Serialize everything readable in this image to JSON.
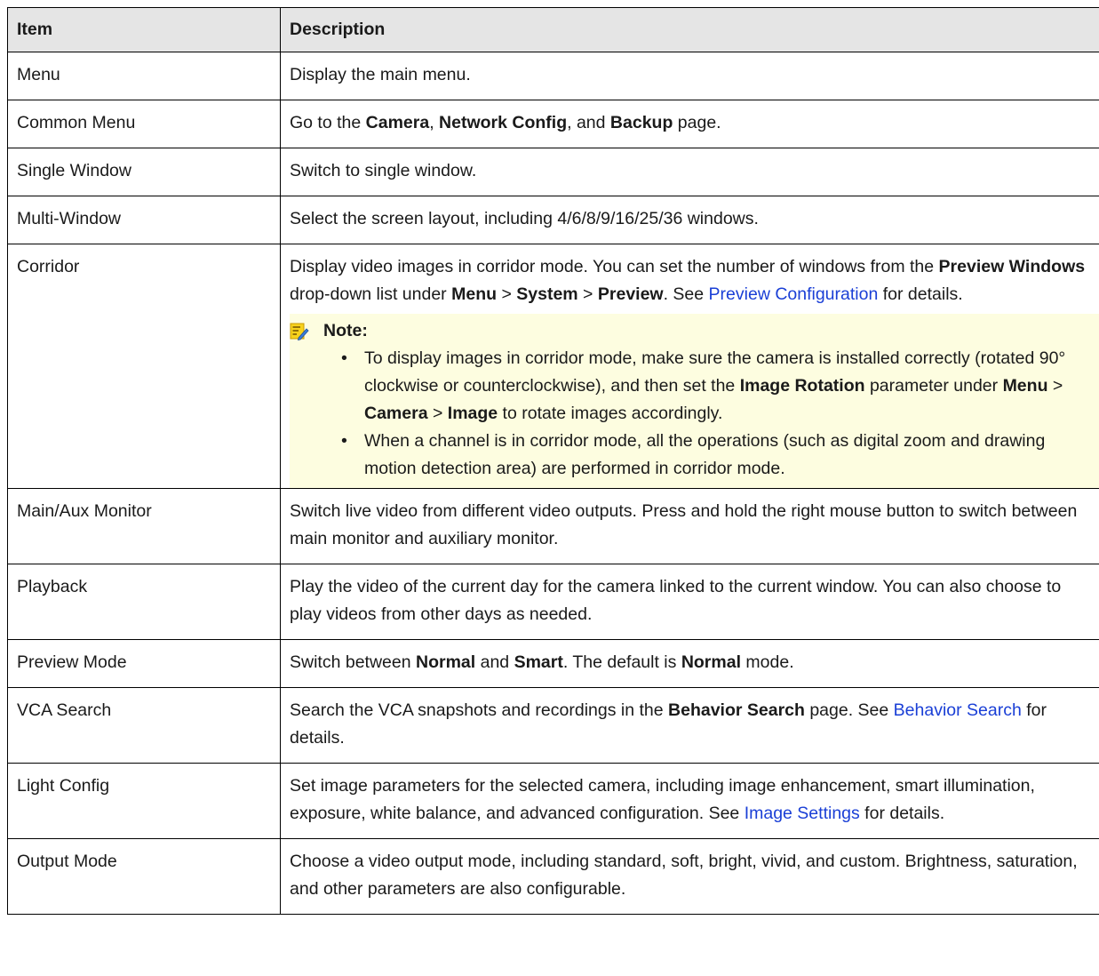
{
  "header": {
    "item": "Item",
    "description": "Description"
  },
  "rows": [
    {
      "item": "Menu",
      "desc": "Display the main menu."
    },
    {
      "item": "Common Menu",
      "desc": {
        "t1": "Go to the ",
        "b1": "Camera",
        "t2": ", ",
        "b2": "Network Config",
        "t3": ", and ",
        "b3": "Backup",
        "t4": " page."
      }
    },
    {
      "item": "Single Window",
      "desc": "Switch to single window."
    },
    {
      "item": "Multi-Window",
      "desc": "Select the screen layout, including 4/6/8/9/16/25/36 windows."
    },
    {
      "item": "Corridor",
      "desc": {
        "t1": "Display video images in corridor mode. You can set the number of windows from the ",
        "b1": "Preview Windows",
        "t2": " drop-down list under ",
        "b2": "Menu",
        "t3": " > ",
        "b3": "System",
        "t4": " > ",
        "b4": "Preview",
        "t5": ". See ",
        "link": "Preview Configuration",
        "t6": " for details.",
        "note": {
          "title": "Note:",
          "icon": "note-pencil-icon",
          "bullet1": {
            "t1": "To display images in corridor mode, make sure the camera is installed correctly (rotated 90° clockwise or counterclockwise), and then set the ",
            "b1": "Image Rotation",
            "t2": " parameter under ",
            "b2": "Menu",
            "t3": " > ",
            "b3": "Camera",
            "t4": " > ",
            "b4": "Image",
            "t5": " to rotate images accordingly."
          },
          "bullet2": "When a channel is in corridor mode, all the operations (such as digital zoom and drawing motion detection area) are performed in corridor mode."
        }
      }
    },
    {
      "item": "Main/Aux Monitor",
      "desc": "Switch live video from different video outputs. Press and hold the right mouse button to switch between main monitor and auxiliary monitor."
    },
    {
      "item": "Playback",
      "desc": "Play the video of the current day for the camera linked to the current window. You can also choose to play videos from other days as needed."
    },
    {
      "item": "Preview Mode",
      "desc": {
        "t1": "Switch between ",
        "b1": "Normal",
        "t2": " and ",
        "b2": "Smart",
        "t3": ". The default is ",
        "b3": "Normal",
        "t4": " mode."
      }
    },
    {
      "item": "VCA Search",
      "desc": {
        "t1": "Search the VCA snapshots and recordings in the ",
        "b1": "Behavior Search",
        "t2": " page. See ",
        "link": "Behavior Search",
        "t3": " for details."
      }
    },
    {
      "item": "Light Config",
      "desc": {
        "t1": "Set image parameters for the selected camera, including image enhancement, smart illumination, exposure, white balance, and advanced configuration. See ",
        "link": "Image Settings",
        "t2": " for details."
      }
    },
    {
      "item": "Output Mode",
      "desc": "Choose a video output mode, including standard, soft, bright, vivid, and custom. Brightness, saturation, and other parameters are also configurable."
    }
  ]
}
